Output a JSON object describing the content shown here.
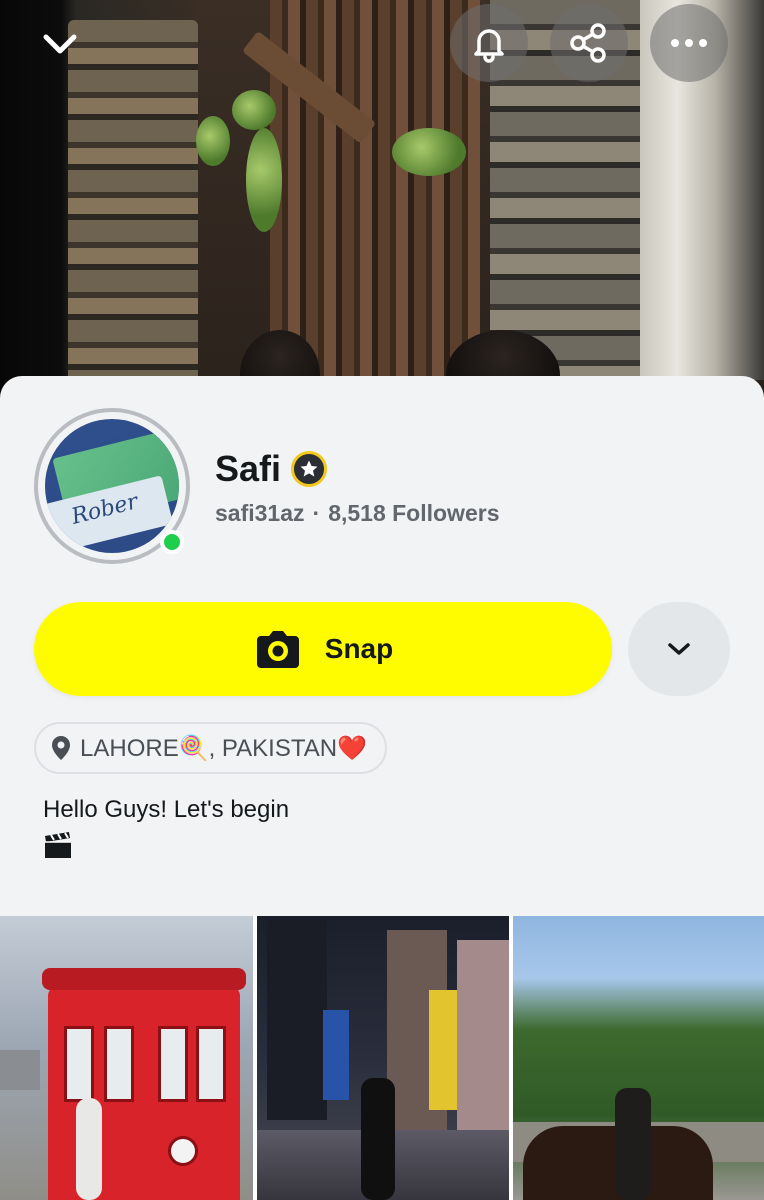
{
  "header": {
    "back_icon": "chevron-down-icon",
    "actions": [
      "bell-icon",
      "share-icon",
      "more-icon"
    ]
  },
  "profile": {
    "display_name": "Safi",
    "username": "safi31az",
    "separator": "·",
    "followers": "8,518 Followers",
    "online": true,
    "badge_icon": "star-badge-icon",
    "avatar_text": "Rober"
  },
  "actions": {
    "snap_label": "Snap",
    "more_icon": "chevron-down-icon"
  },
  "location": {
    "text": "LAHORE🍭, PAKISTAN❤️"
  },
  "bio": {
    "text": "Hello Guys! Let's begin",
    "emoji": "🎬"
  },
  "grid": {
    "tiles": [
      "tram-photo",
      "times-square-photo",
      "horse-riding-photo"
    ]
  },
  "colors": {
    "snap_yellow": "#FFFC00",
    "online_green": "#1FCE4B",
    "card_bg": "#F1F3F5"
  }
}
